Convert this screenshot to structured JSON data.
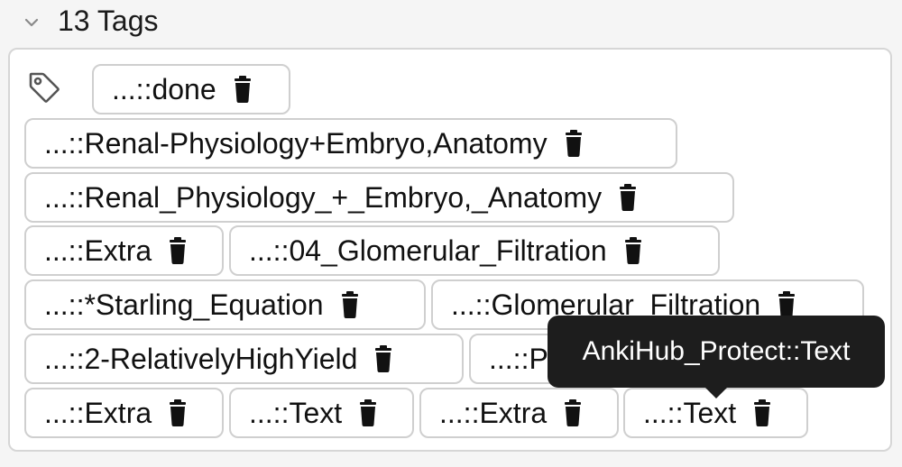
{
  "header": {
    "title": "13 Tags"
  },
  "tags": [
    {
      "label": "...::done"
    },
    {
      "label": "...::Renal-Physiology+Embryo,Anatomy"
    },
    {
      "label": "...::Renal_Physiology_+_Embryo,_Anatomy"
    },
    {
      "label": "...::Extra"
    },
    {
      "label": "...::04_Glomerular_Filtration"
    },
    {
      "label": "...::*Starling_Equation"
    },
    {
      "label": "...::Glomerular_Filtration"
    },
    {
      "label": "...::2-RelativelyHighYield"
    },
    {
      "label": "...::Physiology"
    },
    {
      "label": "...::Extra"
    },
    {
      "label": "...::Text"
    },
    {
      "label": "...::Extra"
    },
    {
      "label": "...::Text"
    }
  ],
  "tooltip": {
    "text": "AnkiHub_Protect::Text"
  }
}
